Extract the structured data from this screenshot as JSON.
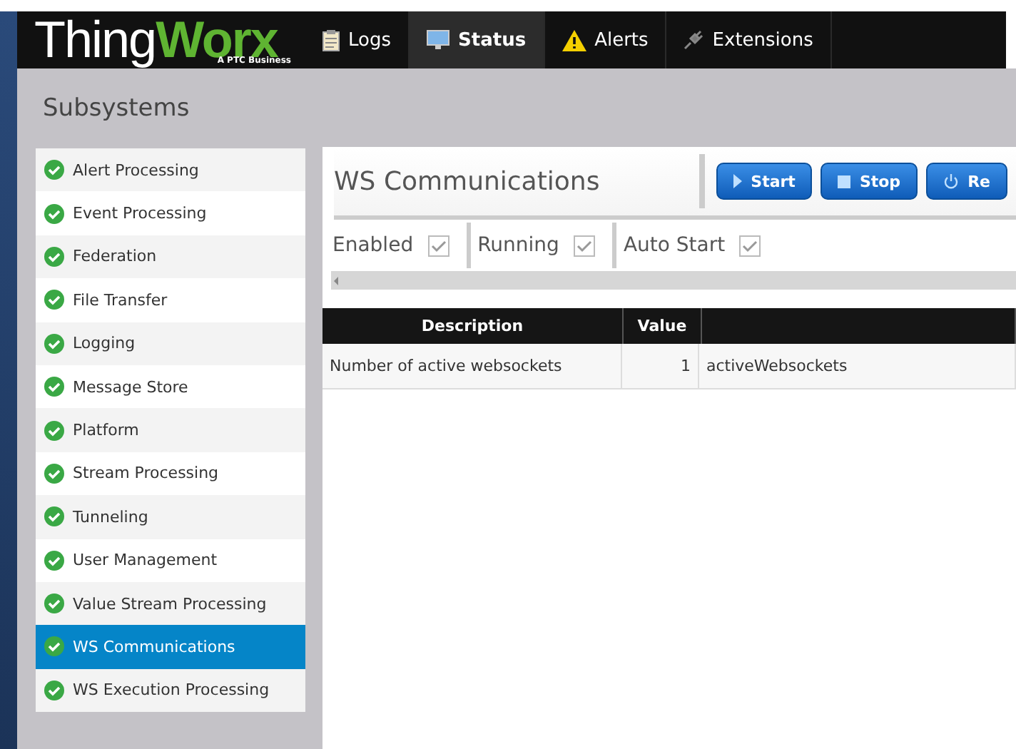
{
  "logo": {
    "word_a": "Thing",
    "word_b": "Worx",
    "tagline": "A PTC Business"
  },
  "nav": [
    {
      "label": "Logs",
      "kind": "logs",
      "selected": false
    },
    {
      "label": "Status",
      "kind": "status",
      "selected": true
    },
    {
      "label": "Alerts",
      "kind": "alerts",
      "selected": false
    },
    {
      "label": "Extensions",
      "kind": "extensions",
      "selected": false
    }
  ],
  "page_title": "Subsystems",
  "subsystems": [
    {
      "name": "Alert Processing",
      "ok": true,
      "selected": false
    },
    {
      "name": "Event Processing",
      "ok": true,
      "selected": false
    },
    {
      "name": "Federation",
      "ok": true,
      "selected": false
    },
    {
      "name": "File Transfer",
      "ok": true,
      "selected": false
    },
    {
      "name": "Logging",
      "ok": true,
      "selected": false
    },
    {
      "name": "Message Store",
      "ok": true,
      "selected": false
    },
    {
      "name": "Platform",
      "ok": true,
      "selected": false
    },
    {
      "name": "Stream Processing",
      "ok": true,
      "selected": false
    },
    {
      "name": "Tunneling",
      "ok": true,
      "selected": false
    },
    {
      "name": "User Management",
      "ok": true,
      "selected": false
    },
    {
      "name": "Value Stream Processing",
      "ok": true,
      "selected": false
    },
    {
      "name": "WS Communications",
      "ok": true,
      "selected": true
    },
    {
      "name": "WS Execution Processing",
      "ok": true,
      "selected": false
    }
  ],
  "detail": {
    "title": "WS Communications",
    "buttons": [
      {
        "label": "Start",
        "kind": "start"
      },
      {
        "label": "Stop",
        "kind": "stop"
      },
      {
        "label": "Re",
        "kind": "restart"
      }
    ],
    "flags": [
      {
        "label": "Enabled",
        "checked": true
      },
      {
        "label": "Running",
        "checked": true
      },
      {
        "label": "Auto Start",
        "checked": true
      }
    ],
    "table": {
      "columns": [
        "Description",
        "Value"
      ],
      "rows": [
        [
          "Number of active websockets",
          "1",
          "activeWebsockets"
        ]
      ]
    }
  }
}
